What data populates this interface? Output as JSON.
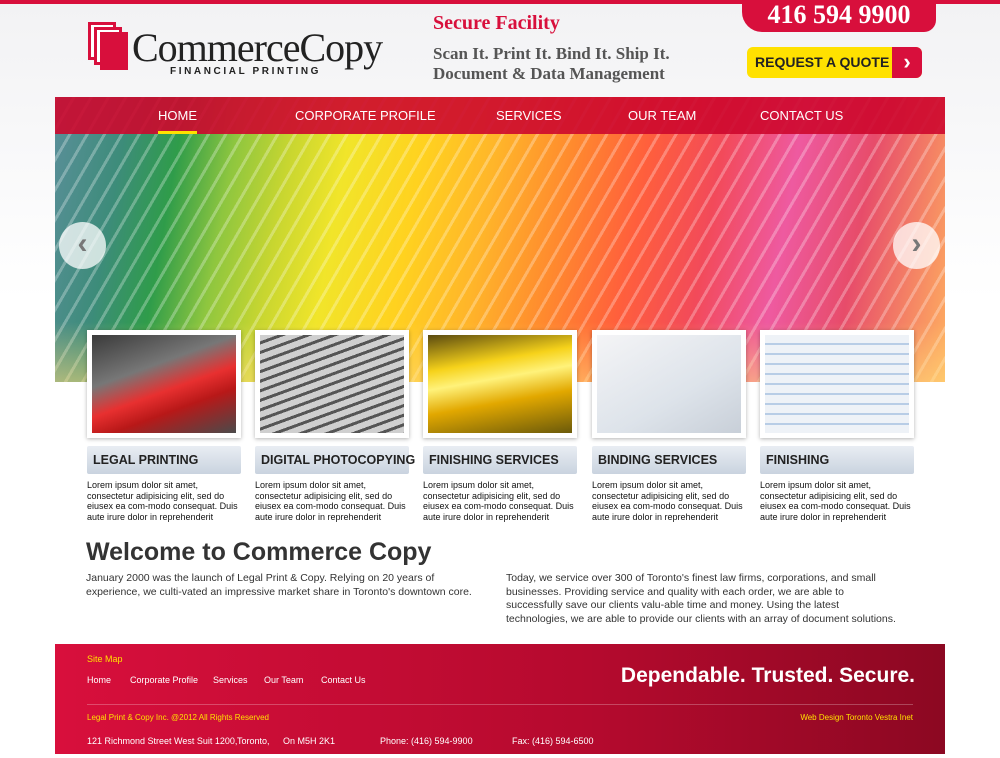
{
  "header": {
    "phone": "416 594 9900",
    "logo": {
      "name": "CommerceCopy",
      "subtitle": "FINANCIAL PRINTING"
    },
    "secure": "Secure Facility",
    "tagline_line1": "Scan It. Print It. Bind It. Ship It.",
    "tagline_line2": "Document & Data Management",
    "quote_button": "REQUEST A QUOTE"
  },
  "nav": {
    "items": [
      {
        "label": "HOME",
        "active": true
      },
      {
        "label": "CORPORATE PROFILE"
      },
      {
        "label": "SERVICES"
      },
      {
        "label": "OUR TEAM"
      },
      {
        "label": "CONTACT US"
      }
    ]
  },
  "slider": {
    "prev_icon": "chevron-left-icon",
    "next_icon": "chevron-right-icon"
  },
  "services": [
    {
      "title": "LEGAL PRINTING",
      "text": "Lorem ipsum dolor sit amet, consectetur adipisicing elit, sed do eiusex ea com-modo consequat. Duis aute irure dolor in reprehenderit"
    },
    {
      "title": "DIGITAL PHOTOCOPYING",
      "text": "Lorem ipsum dolor sit amet, consectetur adipisicing elit, sed do eiusex ea com-modo consequat. Duis aute irure dolor in reprehenderit"
    },
    {
      "title": "FINISHING SERVICES",
      "text": "Lorem ipsum dolor sit amet, consectetur adipisicing elit, sed do eiusex ea com-modo consequat. Duis aute irure dolor in reprehenderit"
    },
    {
      "title": "BINDING SERVICES",
      "text": "Lorem ipsum dolor sit amet, consectetur adipisicing elit, sed do eiusex ea com-modo consequat. Duis aute irure dolor in reprehenderit"
    },
    {
      "title": "FINISHING",
      "text": "Lorem ipsum dolor sit amet, consectetur adipisicing elit, sed do eiusex ea com-modo consequat. Duis aute irure dolor in reprehenderit"
    }
  ],
  "welcome": {
    "title": "Welcome to Commerce Copy",
    "left": "January 2000 was the launch of Legal Print & Copy. Relying on 20 years of experience, we culti-vated an impressive market share in Toronto's downtown core.",
    "right": "Today, we service over 300 of Toronto's finest law firms, corporations, and small businesses. Providing service and quality with each order, we are able to successfully save our clients valu-able time and money. Using the latest technologies, we are able to provide our clients with an array of document solutions."
  },
  "footer": {
    "sitemap": "Site Map",
    "links": [
      "Home",
      "Corporate Profile",
      "Services",
      "Our Team",
      "Contact Us"
    ],
    "slogan": "Dependable. Trusted. Secure.",
    "copyright": "Legal Print & Copy Inc. @2012 All Rights Reserved",
    "credit": "Web Design Toronto Vestra Inet",
    "address": "121 Richmond Street West Suit 1200,",
    "city": "Toronto,",
    "postal": "On M5H 2K1",
    "phone": "Phone: (416) 594-9900",
    "fax": "Fax: (416) 594-6500"
  },
  "colors": {
    "brand_red": "#d80f3c",
    "accent_yellow": "#ffe100"
  }
}
